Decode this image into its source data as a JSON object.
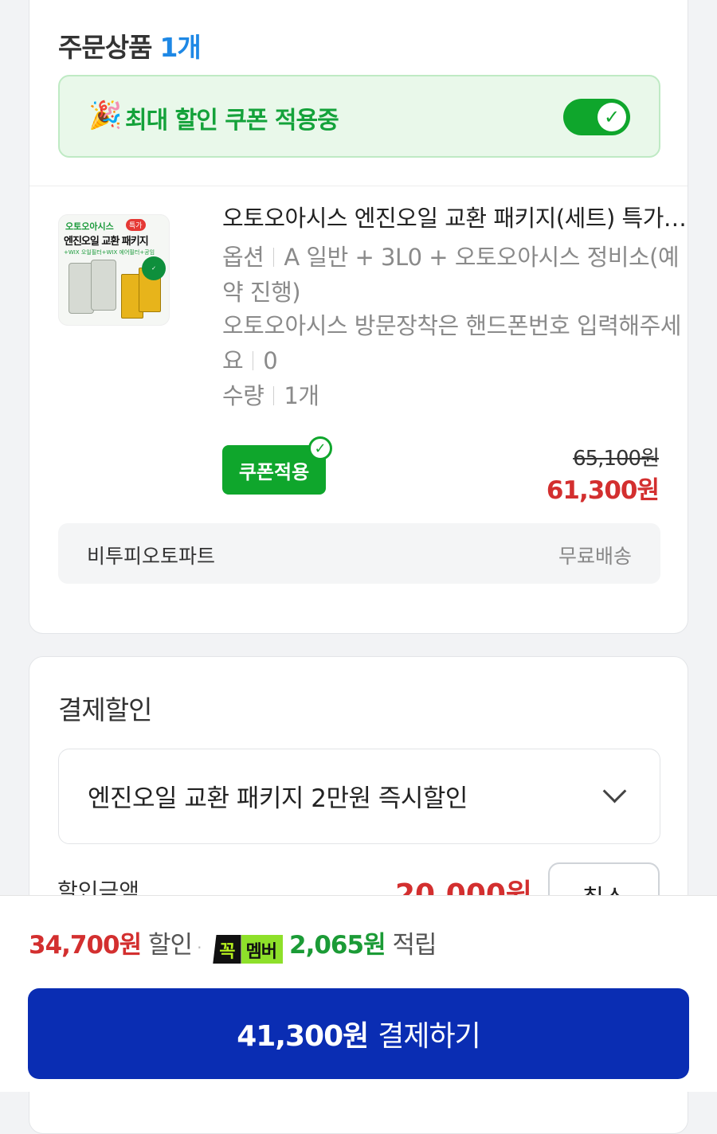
{
  "order": {
    "title": "주문상품",
    "count": "1개",
    "coupon_banner": {
      "icon": "🎉",
      "label": "최대 할인 쿠폰 적용중",
      "toggle_on": true
    },
    "product": {
      "name": "오토오아시스 엔진오일 교환 패키지(세트) 특가 WIX 오일필터 에어필터 공임",
      "thumbnail": {
        "brand": "오토오아시스",
        "badge": "특가",
        "title": "엔진오일 교환 패키지",
        "subtitle": "+WIX 오일필터+WIX 에어필터+공임"
      },
      "option_label": "옵션",
      "option_value": "A 일반 + 3L0 + 오토오아시스 정비소(예약 진행)",
      "request_label": "오토오아시스 방문장착은 핸드폰번호 입력해주세요",
      "request_value": "0",
      "qty_label": "수량",
      "qty_value": "1개",
      "coupon_button": "쿠폰적용",
      "original_price": "65,100원",
      "sale_price": "61,300원"
    },
    "seller": {
      "name": "비투피오토파트",
      "shipping": "무료배송"
    }
  },
  "payment_discount": {
    "title": "결제할인",
    "selected": "엔진오일 교환 패키지 2만원 즉시할인",
    "amount_label": "할인금액",
    "amount": "20,000원",
    "cancel": "취소"
  },
  "footer": {
    "discount": "34,700원",
    "discount_suffix": "할인",
    "separator": "·",
    "member_k": "꼭",
    "member_m": "멤버",
    "points": "2,065원",
    "points_suffix": "적립",
    "pay_amount": "41,300원",
    "pay_label": "결제하기"
  },
  "colors": {
    "accent_blue": "#0a2db3",
    "coupon_green": "#0fa62c",
    "price_red": "#d32f2f"
  }
}
